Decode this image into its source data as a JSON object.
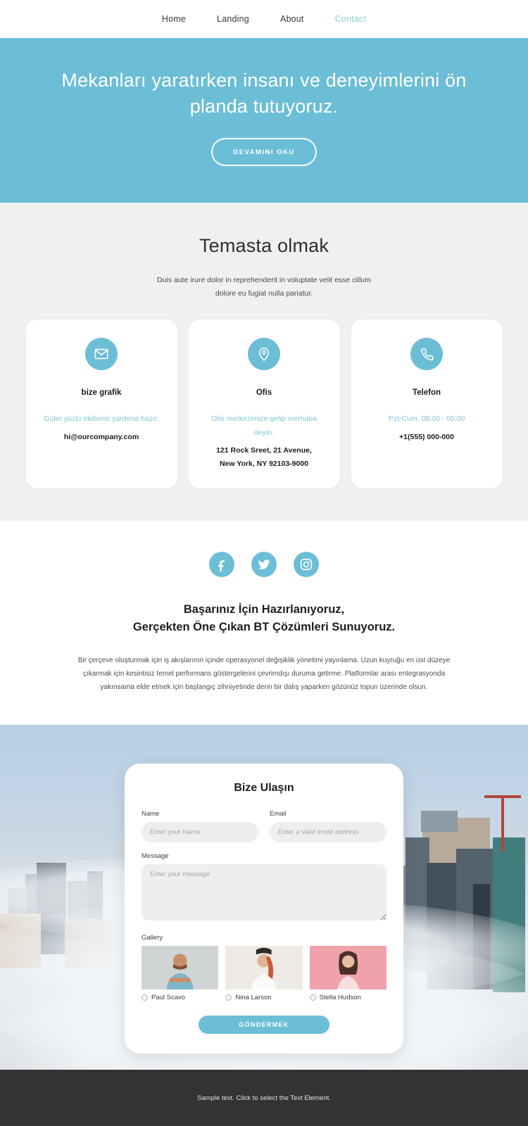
{
  "nav": {
    "items": [
      {
        "label": "Home",
        "active": false
      },
      {
        "label": "Landing",
        "active": false
      },
      {
        "label": "About",
        "active": false
      },
      {
        "label": "Contact",
        "active": true
      }
    ]
  },
  "hero": {
    "title": "Mekanları yaratırken insanı ve deneyimlerini ön planda tutuyoruz.",
    "button_label": "DEVAMINI OKU",
    "bg_color": "#6bbed6"
  },
  "contact": {
    "title": "Temasta olmak",
    "subtitle": "Duis aute irure dolor in reprehenderit in voluptate velit esse cillum dolore eu fugiat nulla pariatur.",
    "accent_color": "#6bbed6",
    "cards": [
      {
        "icon": "envelope-icon",
        "title": "bize grafik",
        "note": "Güler yüzlü ekibimiz yardıma hazır.",
        "value": "hi@ourcompany.com"
      },
      {
        "icon": "map-pin-icon",
        "title": "Ofis",
        "note": "Ofis merkezimize gelip merhaba deyin.",
        "value": "121 Rock Sreet, 21 Avenue,\nNew York, NY 92103-9000"
      },
      {
        "icon": "phone-icon",
        "title": "Telefon",
        "note": "Pzt-Cum, 08:00 - 05:00",
        "value": "+1(555) 000-000"
      }
    ]
  },
  "about": {
    "socials": [
      {
        "icon": "facebook-icon",
        "name": "Facebook"
      },
      {
        "icon": "twitter-icon",
        "name": "Twitter"
      },
      {
        "icon": "instagram-icon",
        "name": "Instagram"
      }
    ],
    "title": "Başarınız İçin Hazırlanıyoruz,\nGerçekten Öne Çıkan BT Çözümleri Sunuyoruz.",
    "body": "Bir çerçeve oluşturmak için iş akışlarının içinde operasyonel değişiklik yönetimi yayınlama. Uzun kuyruğu en üst düzeye çıkarmak için kesintisiz temel performans göstergelerini çevrimdışı duruma getirme. Platformlar arası entegrasyonda yakınsama elde etmek için başlangıç zihniyetinde derin bir dalış yaparken gözünüz topun üzerinde olsun."
  },
  "form": {
    "title": "Bize Ulaşın",
    "name_label": "Name",
    "name_placeholder": "Enter your Name",
    "name_value": "",
    "email_label": "Email",
    "email_placeholder": "Enter a valid email address",
    "email_value": "",
    "message_label": "Message",
    "message_placeholder": "Enter your message",
    "message_value": "",
    "gallery_label": "Gallery",
    "gallery": [
      {
        "name": "Paul Scavo",
        "selected": false,
        "bg": "#cfd3d4"
      },
      {
        "name": "Nina Larson",
        "selected": false,
        "bg": "#efece9"
      },
      {
        "name": "Stella Hudson",
        "selected": false,
        "bg": "#f0a8ae"
      }
    ],
    "submit_label": "GÖNDERMEK",
    "submit_color": "#6bbed6"
  },
  "footer": {
    "text": "Sample text. Click to select the Text Element.",
    "bg_color": "#333333"
  }
}
